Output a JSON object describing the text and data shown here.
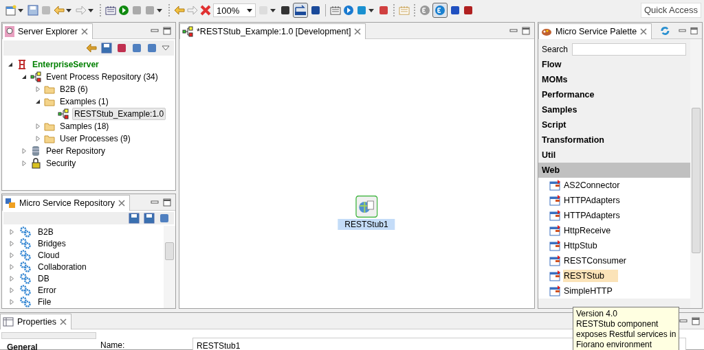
{
  "toolbar": {
    "zoom_value": "100%",
    "layout_toggle": {
      "pressed": true
    },
    "server_toggle": {
      "pressed": true
    },
    "quick_access": {
      "placeholder": "Quick Access"
    }
  },
  "server_explorer": {
    "title": "Server Explorer",
    "tree": [
      {
        "label": "EnterpriseServer",
        "kind": "server",
        "expanded": true,
        "selected": false,
        "children": [
          {
            "label": "Event Process Repository (34)",
            "kind": "repository",
            "expanded": true,
            "selected": false,
            "children": [
              {
                "label": "B2B (6)",
                "kind": "folder",
                "expanded": false,
                "selected": false
              },
              {
                "label": "Examples (1)",
                "kind": "folder",
                "expanded": true,
                "selected": false,
                "children": [
                  {
                    "label": "RESTStub_Example:1.0",
                    "kind": "process",
                    "selected": true
                  }
                ]
              },
              {
                "label": "Samples (18)",
                "kind": "folder",
                "expanded": false,
                "selected": false
              },
              {
                "label": "User Processes (9)",
                "kind": "folder",
                "expanded": false,
                "selected": false
              }
            ]
          },
          {
            "label": "Peer Repository",
            "kind": "database",
            "expanded": false,
            "selected": false
          },
          {
            "label": "Security",
            "kind": "lock",
            "expanded": false,
            "selected": false
          }
        ]
      }
    ]
  },
  "repository": {
    "title": "Micro Service Repository",
    "items": [
      {
        "label": "B2B",
        "expanded": false
      },
      {
        "label": "Bridges",
        "expanded": false
      },
      {
        "label": "Cloud",
        "expanded": false
      },
      {
        "label": "Collaboration",
        "expanded": false
      },
      {
        "label": "DB",
        "expanded": false
      },
      {
        "label": "Error",
        "expanded": false
      },
      {
        "label": "File",
        "expanded": false
      }
    ]
  },
  "editor": {
    "title": "*RESTStub_Example:1.0 [Development]",
    "nodes": [
      {
        "label": "RESTStub1",
        "selected": true
      }
    ]
  },
  "palette": {
    "title": "Micro Service Palette",
    "search_label": "Search",
    "items": [
      {
        "label": "Flow",
        "kind": "category",
        "selected": false
      },
      {
        "label": "MOMs",
        "kind": "category",
        "selected": false
      },
      {
        "label": "Performance",
        "kind": "category",
        "selected": false
      },
      {
        "label": "Samples",
        "kind": "category",
        "selected": false
      },
      {
        "label": "Script",
        "kind": "category",
        "selected": false
      },
      {
        "label": "Transformation",
        "kind": "category",
        "selected": false
      },
      {
        "label": "Util",
        "kind": "category",
        "selected": false
      },
      {
        "label": "Web",
        "kind": "category",
        "selected": true
      },
      {
        "label": "AS2Connector",
        "kind": "component",
        "selected": false
      },
      {
        "label": "HTTPAdapters",
        "kind": "component",
        "selected": false
      },
      {
        "label": "HTTPAdapters",
        "kind": "component",
        "selected": false
      },
      {
        "label": "HttpReceive",
        "kind": "component",
        "selected": false
      },
      {
        "label": "HttpStub",
        "kind": "component",
        "selected": false
      },
      {
        "label": "RESTConsumer",
        "kind": "component",
        "selected": false
      },
      {
        "label": "RESTStub",
        "kind": "component",
        "selected": true
      },
      {
        "label": "SimpleHTTP",
        "kind": "component",
        "selected": false
      }
    ]
  },
  "tooltip": {
    "lines": [
      "Version 4.0",
      "RESTStub component",
      "exposes Restful services in",
      "Fiorano environment"
    ]
  },
  "properties": {
    "title": "Properties",
    "sections": [
      {
        "label": "General",
        "selected": true
      }
    ],
    "fields": [
      {
        "label": "Name:",
        "value": "RESTStub1"
      }
    ]
  }
}
